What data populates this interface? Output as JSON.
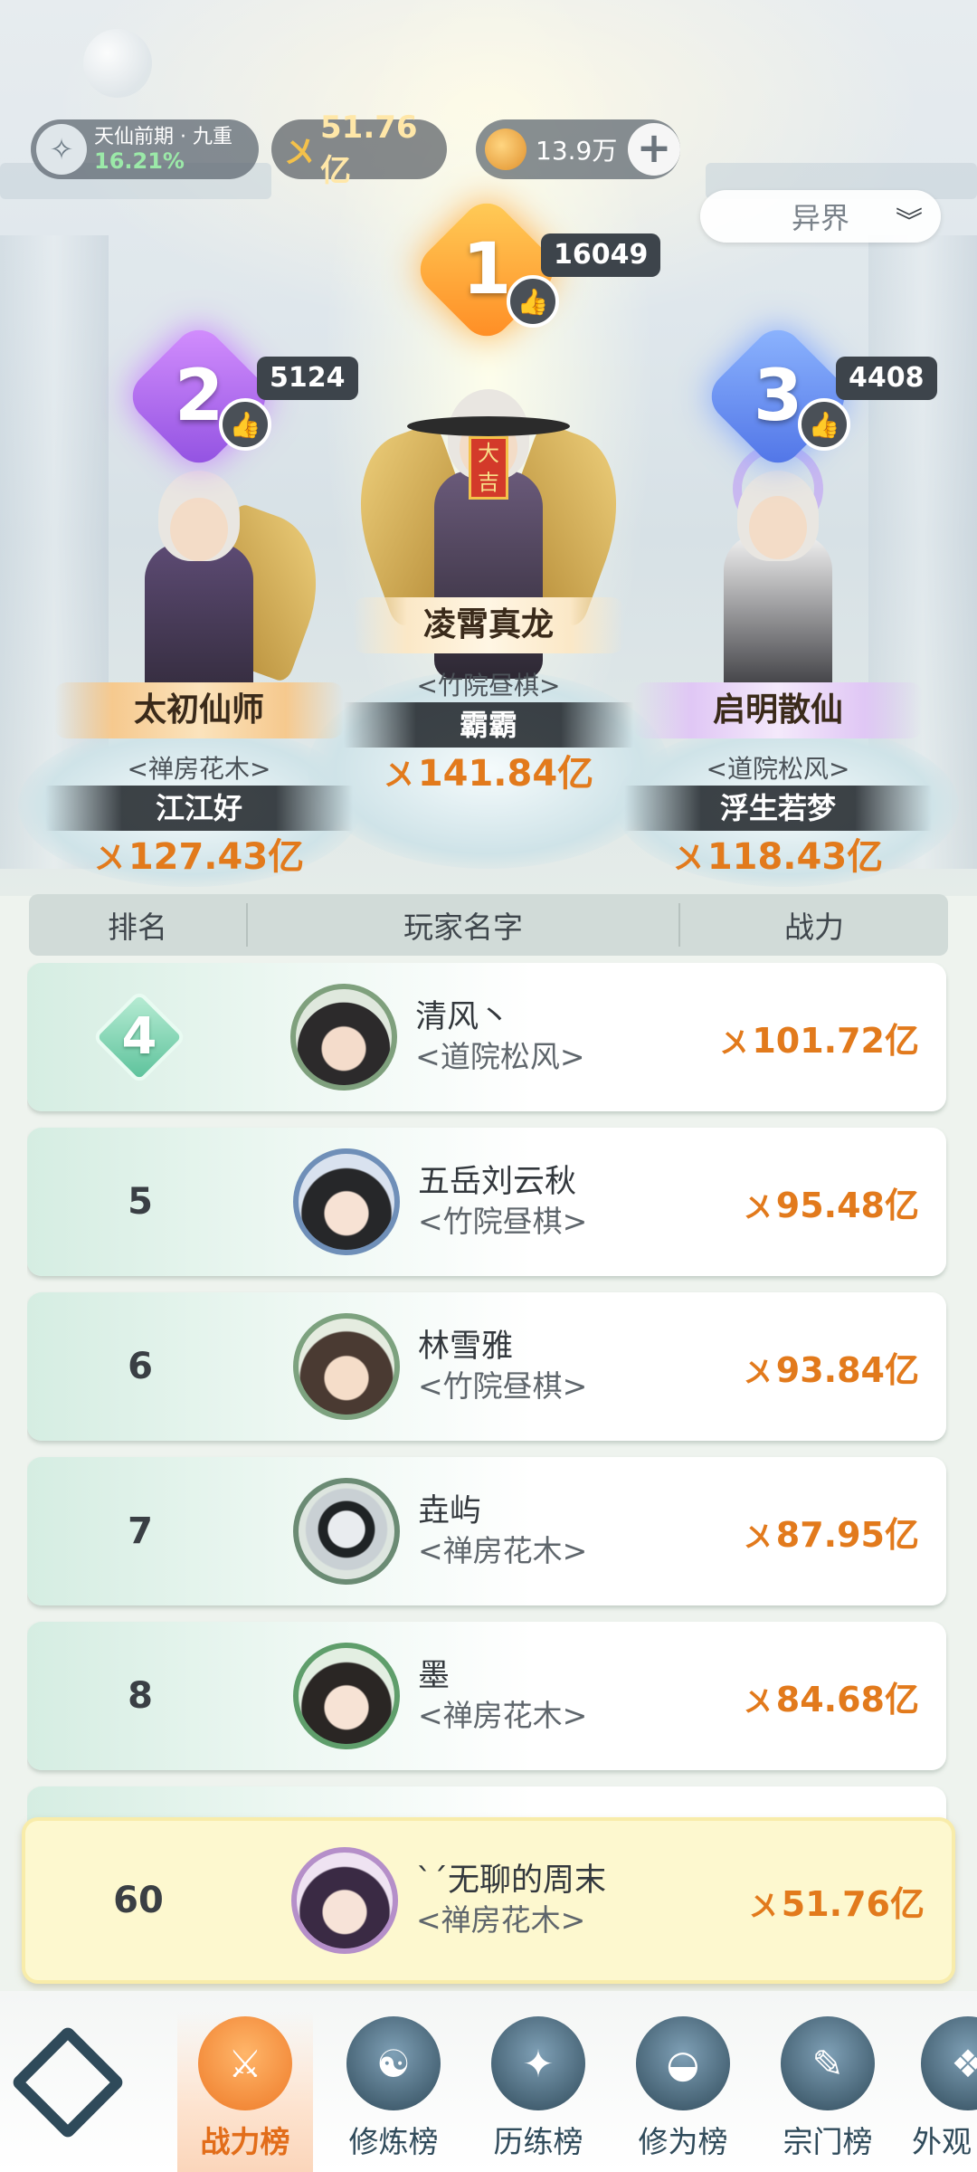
{
  "header": {
    "realm_name": "天仙前期 · 九重",
    "realm_progress": "16.21%",
    "power_value": "51.76亿",
    "coin_value": "13.9万",
    "region": "异界"
  },
  "podium": [
    {
      "rank": "1",
      "likes": "16049",
      "title": "凌霄真龙",
      "guild": "<竹院昼棋>",
      "name": "霸霸",
      "power": "141.84亿"
    },
    {
      "rank": "2",
      "likes": "5124",
      "title": "太初仙师",
      "guild": "<禅房花木>",
      "name": "江江好",
      "power": "127.43亿"
    },
    {
      "rank": "3",
      "likes": "4408",
      "title": "启明散仙",
      "guild": "<道院松风>",
      "name": "浮生若梦",
      "power": "118.43亿"
    }
  ],
  "table": {
    "headers": {
      "rank": "排名",
      "name": "玩家名字",
      "power": "战力"
    },
    "rows": [
      {
        "rank": "4",
        "name": "清风丶",
        "guild": "<道院松风>",
        "power": "101.72亿"
      },
      {
        "rank": "5",
        "name": "五岳刘云秋",
        "guild": "<竹院昼棋>",
        "power": "95.48亿"
      },
      {
        "rank": "6",
        "name": "林雪雅",
        "guild": "<竹院昼棋>",
        "power": "93.84亿"
      },
      {
        "rank": "7",
        "name": "垚屿",
        "guild": "<禅房花木>",
        "power": "87.95亿"
      },
      {
        "rank": "8",
        "name": "墨",
        "guild": "<禅房花木>",
        "power": "84.68亿"
      }
    ]
  },
  "my_rank": {
    "rank": "60",
    "name": "ˋˊ无聊的周末",
    "guild": "<禅房花木>",
    "power": "51.76亿"
  },
  "nav": {
    "items": [
      {
        "label": "战力榜"
      },
      {
        "label": "修炼榜"
      },
      {
        "label": "历练榜"
      },
      {
        "label": "修为榜"
      },
      {
        "label": "宗门榜"
      },
      {
        "label": "外观"
      }
    ]
  },
  "icons": {
    "power_glyph": "〤"
  },
  "colors": {
    "accent_orange": "#e27a1c",
    "table_green": "#d5ede2",
    "self_highlight": "#fdf8cf"
  }
}
